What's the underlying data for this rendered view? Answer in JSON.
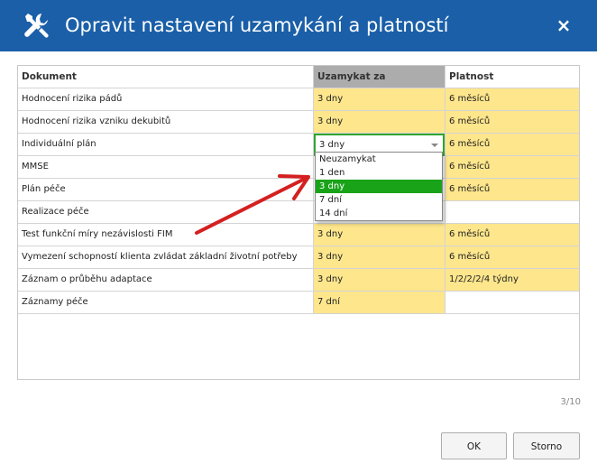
{
  "dialog": {
    "title": "Opravit nastavení uzamykání a platností",
    "close_label": "×",
    "title_icon": "wrench-screwdriver-icon"
  },
  "table": {
    "columns": [
      "Dokument",
      "Uzamykat za",
      "Platnost"
    ],
    "rows": [
      {
        "document": "Hodnocení rizika pádů",
        "lock": "3 dny",
        "validity": "6 měsíců"
      },
      {
        "document": "Hodnocení rizika vzniku dekubitů",
        "lock": "3 dny",
        "validity": "6 měsíců"
      },
      {
        "document": "Individuální plán",
        "lock": "3 dny",
        "validity": "6 měsíců"
      },
      {
        "document": "MMSE",
        "lock": "",
        "validity": "6 měsíců"
      },
      {
        "document": "Plán péče",
        "lock": "",
        "validity": "6 měsíců"
      },
      {
        "document": "Realizace péče",
        "lock": "",
        "validity": ""
      },
      {
        "document": "Test funkční míry nezávislosti FIM",
        "lock": "3 dny",
        "validity": "6 měsíců"
      },
      {
        "document": "Vymezení schopností klienta zvládat základní životní potřeby",
        "lock": "3 dny",
        "validity": "6 měsíců"
      },
      {
        "document": "Záznam o průběhu adaptace",
        "lock": "3 dny",
        "validity": "1/2/2/2/4 týdny"
      },
      {
        "document": "Záznamy péče",
        "lock": "7 dní",
        "validity": ""
      }
    ]
  },
  "editor": {
    "value": "3 dny",
    "options": [
      "Neuzamykat",
      "1 den",
      "3 dny",
      "7 dní",
      "14 dní"
    ],
    "selected": "3 dny"
  },
  "annotation": {
    "type": "arrow",
    "color": "#d42020"
  },
  "colors": {
    "titlebar": "#1a5fa8",
    "highlight": "#fde68c",
    "selected": "#19a319",
    "focus_border": "#2fa52f"
  },
  "footer": {
    "page_counter": "3/10",
    "ok_label": "OK",
    "cancel_label": "Storno"
  }
}
